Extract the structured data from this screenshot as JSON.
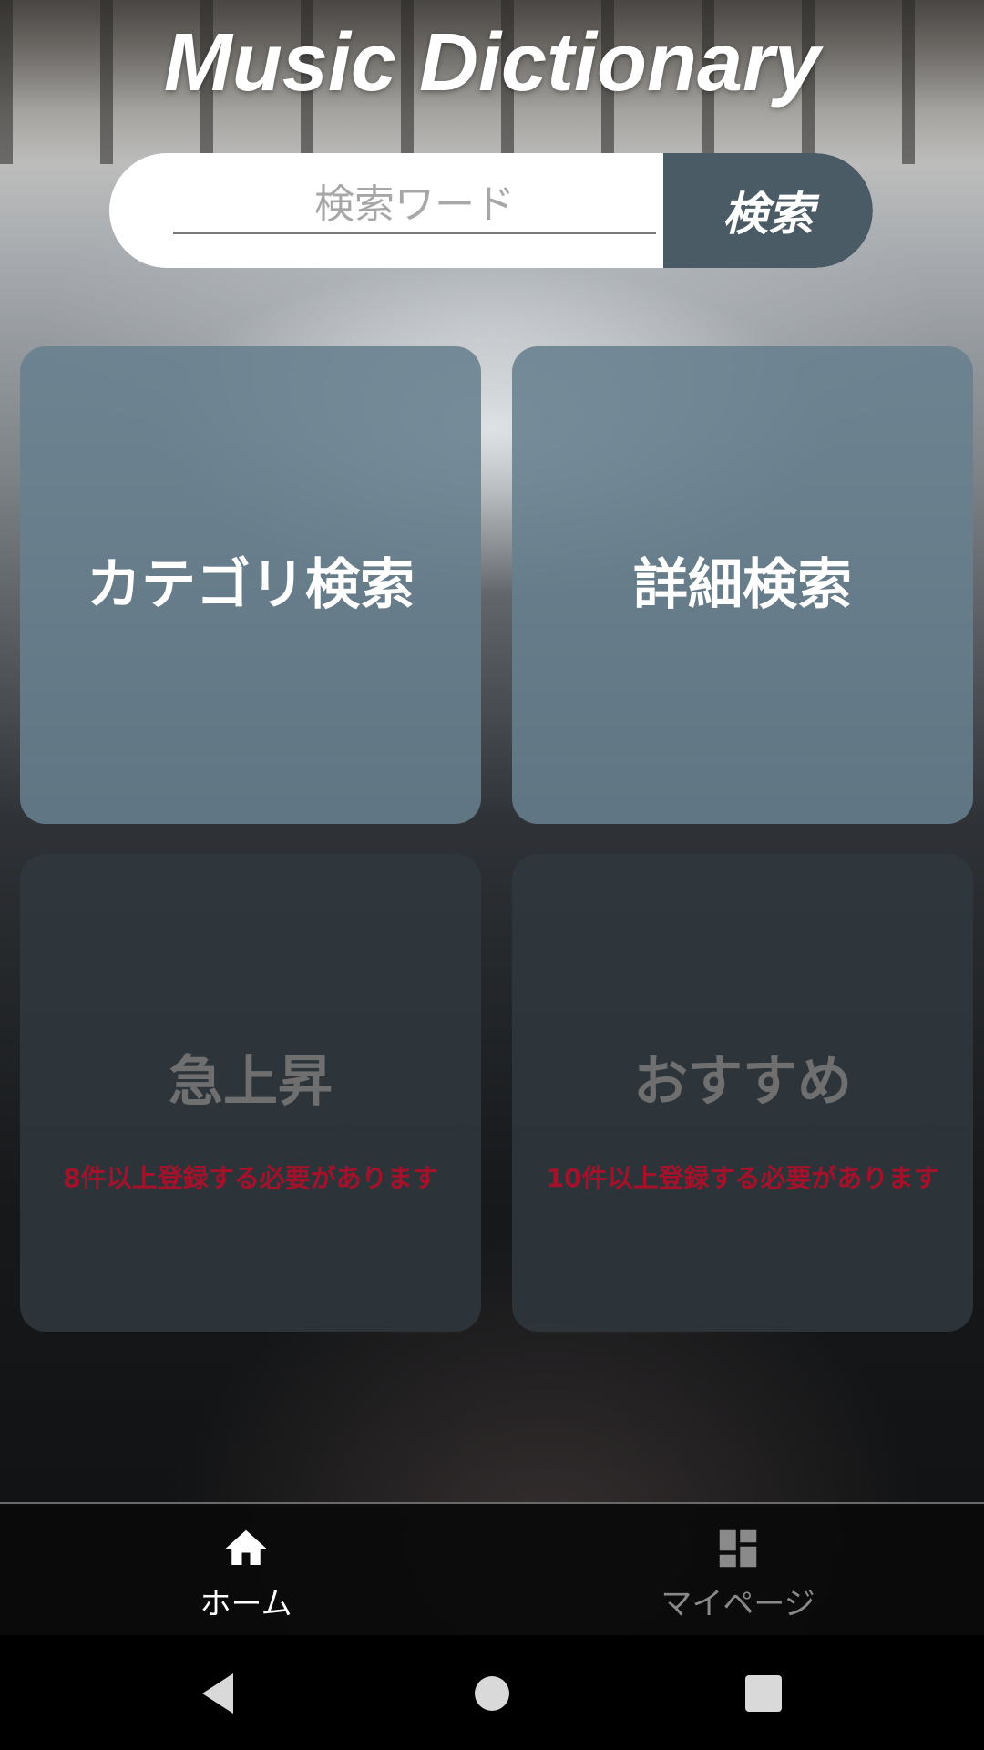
{
  "app": {
    "title": "Music Dictionary"
  },
  "search": {
    "placeholder": "検索ワード",
    "value": "",
    "button_label": "検索"
  },
  "tiles": [
    {
      "label": "カテゴリ検索",
      "state": "enabled",
      "note": ""
    },
    {
      "label": "詳細検索",
      "state": "enabled",
      "note": ""
    },
    {
      "label": "急上昇",
      "state": "disabled",
      "note": "8件以上登録する必要があります"
    },
    {
      "label": "おすすめ",
      "state": "disabled",
      "note": "10件以上登録する必要があります"
    }
  ],
  "bottom_nav": {
    "items": [
      {
        "label": "ホーム",
        "icon": "home-icon",
        "selected": true
      },
      {
        "label": "マイページ",
        "icon": "dashboard-icon",
        "selected": false
      }
    ]
  },
  "system_nav": {
    "icons": [
      "back-triangle-icon",
      "home-circle-icon",
      "recents-square-icon"
    ]
  },
  "colors": {
    "search_button": "#4a5b66",
    "tile_active": "#68808e",
    "tile_disabled": "#30383e",
    "warning_text": "#a3122a"
  }
}
